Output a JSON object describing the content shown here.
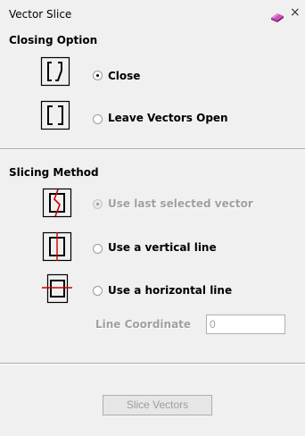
{
  "window": {
    "title": "Vector Slice",
    "pin_icon": "book-pin-icon",
    "close_glyph": "×"
  },
  "closing_option": {
    "title": "Closing Option",
    "options": [
      {
        "label": "Close",
        "icon": "closed-vector-icon",
        "checked": true
      },
      {
        "label": "Leave Vectors Open",
        "icon": "open-vector-icon",
        "checked": false
      }
    ]
  },
  "slicing_method": {
    "title": "Slicing Method",
    "options": [
      {
        "label": "Use last selected vector",
        "icon": "slice-selected-vector-icon",
        "checked": true,
        "enabled": false
      },
      {
        "label": "Use a vertical line",
        "icon": "slice-vertical-line-icon",
        "checked": false,
        "enabled": true
      },
      {
        "label": "Use a horizontal line",
        "icon": "slice-horizontal-line-icon",
        "checked": false,
        "enabled": true
      }
    ],
    "line_coordinate": {
      "label": "Line Coordinate",
      "value": "0"
    }
  },
  "actions": {
    "slice_label": "Slice Vectors"
  },
  "colors": {
    "background": "#f0f0f0",
    "cut_line": "#cc0000",
    "disabled_text": "#a0a0a0"
  }
}
